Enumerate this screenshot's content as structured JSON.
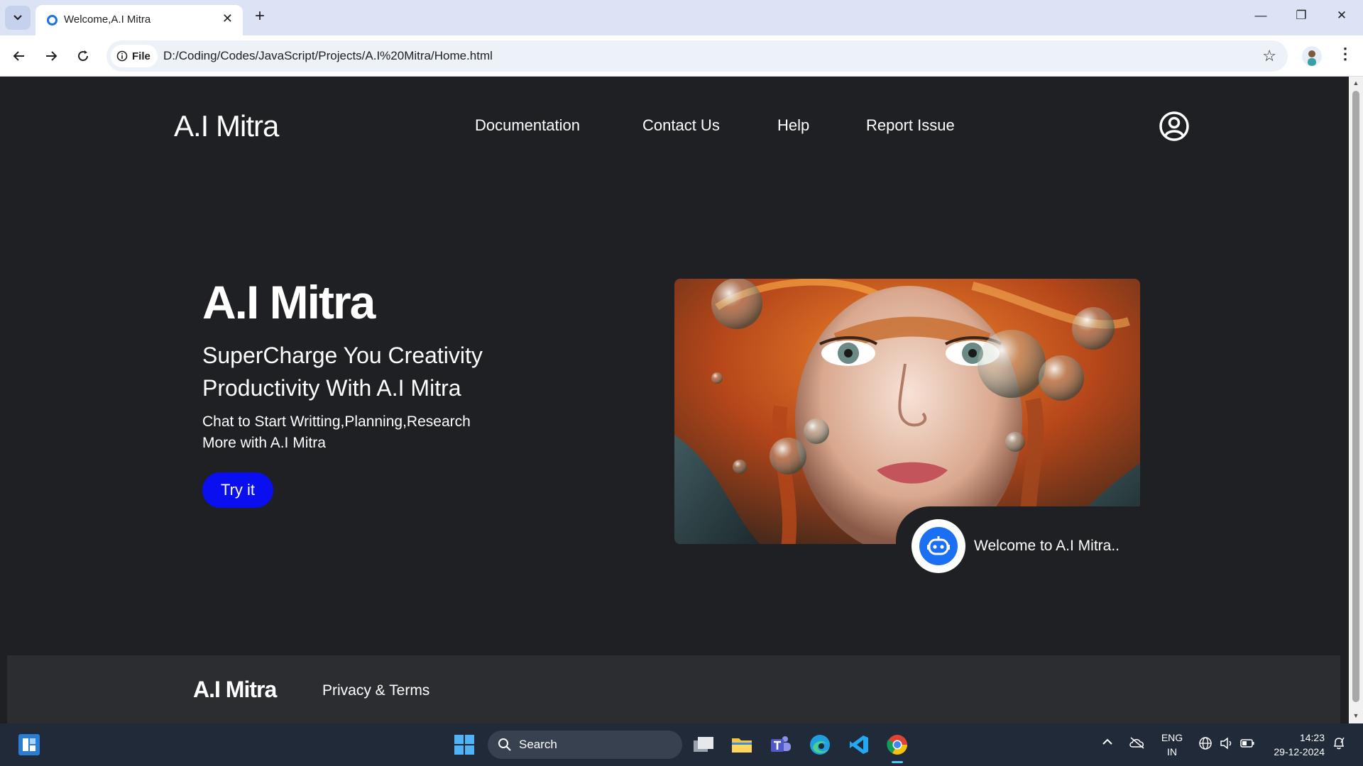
{
  "browser": {
    "tab_title": "Welcome,A.I Mitra",
    "chip_label": "File",
    "url": "D:/Coding/Codes/JavaScript/Projects/A.I%20Mitra/Home.html"
  },
  "site": {
    "logo": "A.I Mitra",
    "nav": [
      "Documentation",
      "Contact Us",
      "Help",
      "Report Issue"
    ],
    "hero": {
      "title": "A.I Mitra",
      "subtitle": "SuperCharge You Creativity Productivity With A.I Mitra",
      "description": "Chat to Start Writting,Planning,Research More with A.I Mitra",
      "cta": "Try it"
    },
    "welcome": "Welcome to A.I Mitra..",
    "footer": {
      "logo": "A.I Mitra",
      "link": "Privacy & Terms"
    }
  },
  "taskbar": {
    "search_label": "Search",
    "lang_top": "ENG",
    "lang_bottom": "IN",
    "time": "14:23",
    "date": "29-12-2024"
  },
  "colors": {
    "page_bg": "#1f2023",
    "footer_bg": "#2b2d31",
    "cta": "#0a0fef",
    "bot": "#1a6ff2"
  }
}
